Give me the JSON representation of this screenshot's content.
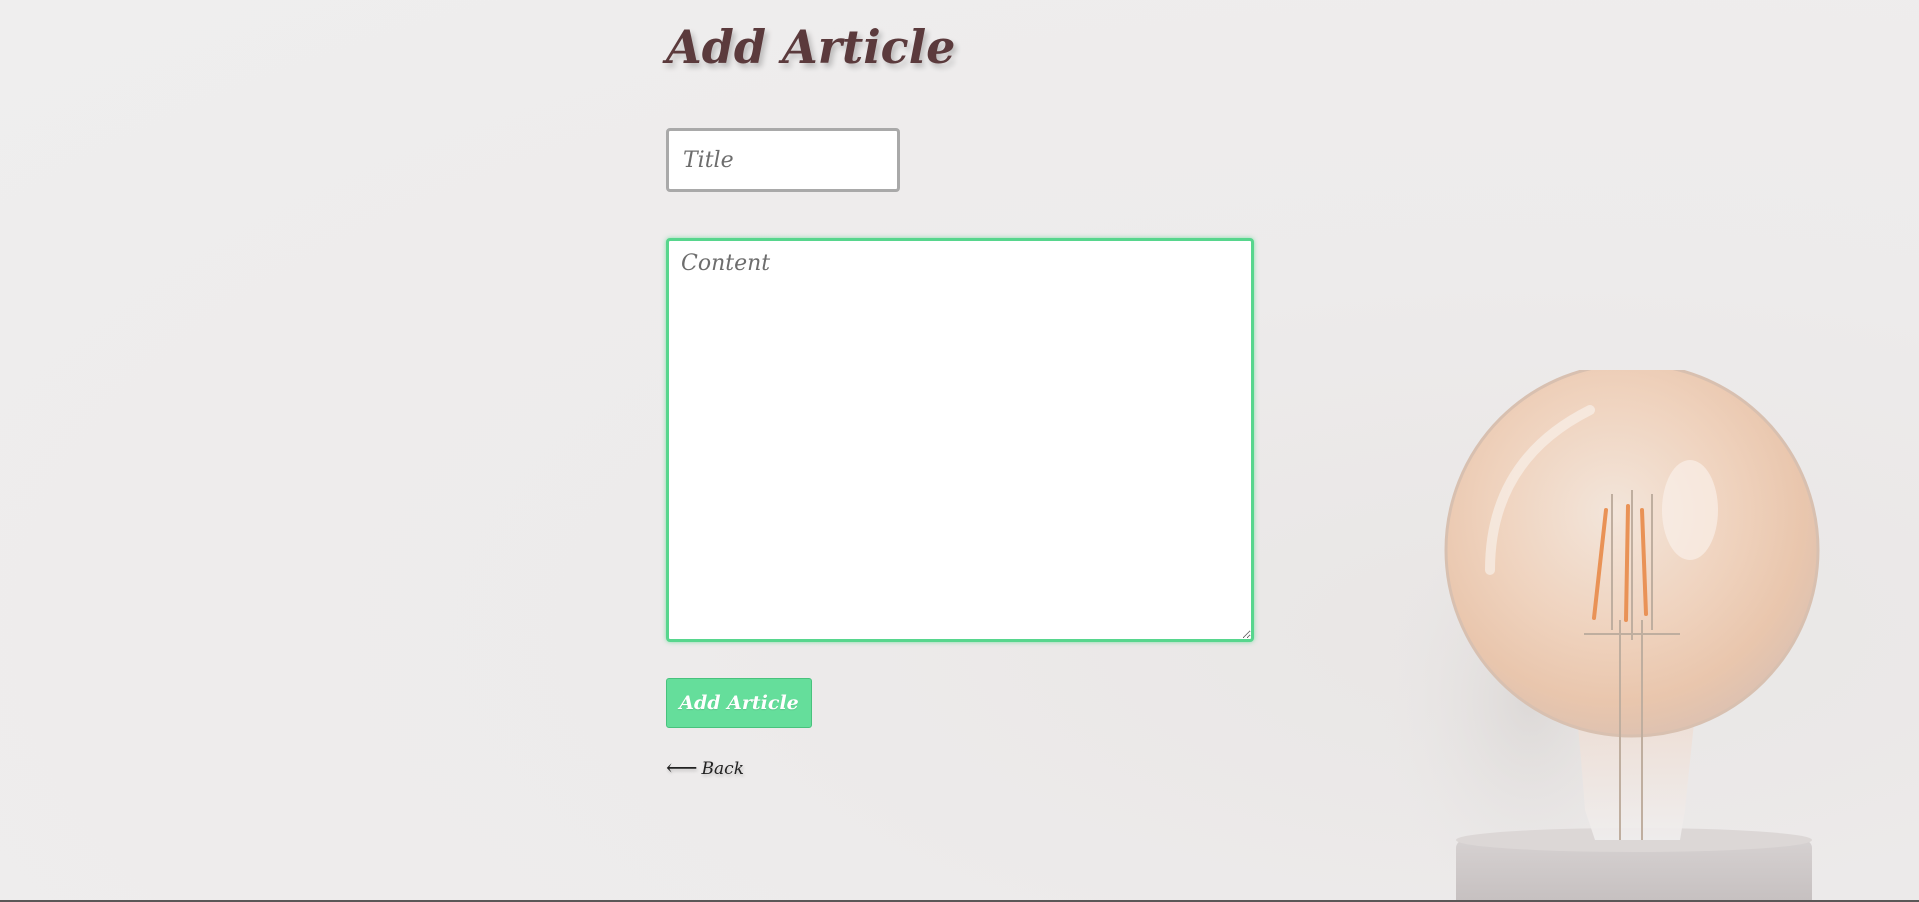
{
  "page": {
    "title": "Add Article"
  },
  "form": {
    "title_placeholder": "Title",
    "title_value": "",
    "content_placeholder": "Content",
    "content_value": "",
    "submit_label": "Add Article"
  },
  "nav": {
    "back_arrow": "⟵",
    "back_label": "Back"
  },
  "colors": {
    "title": "#5b3a3c",
    "accent_green": "#65de9b",
    "focus_border": "#57d68d",
    "background": "#efeeee"
  },
  "icons": {
    "back": "left-arrow-icon",
    "decor": "light-bulb-icon"
  }
}
